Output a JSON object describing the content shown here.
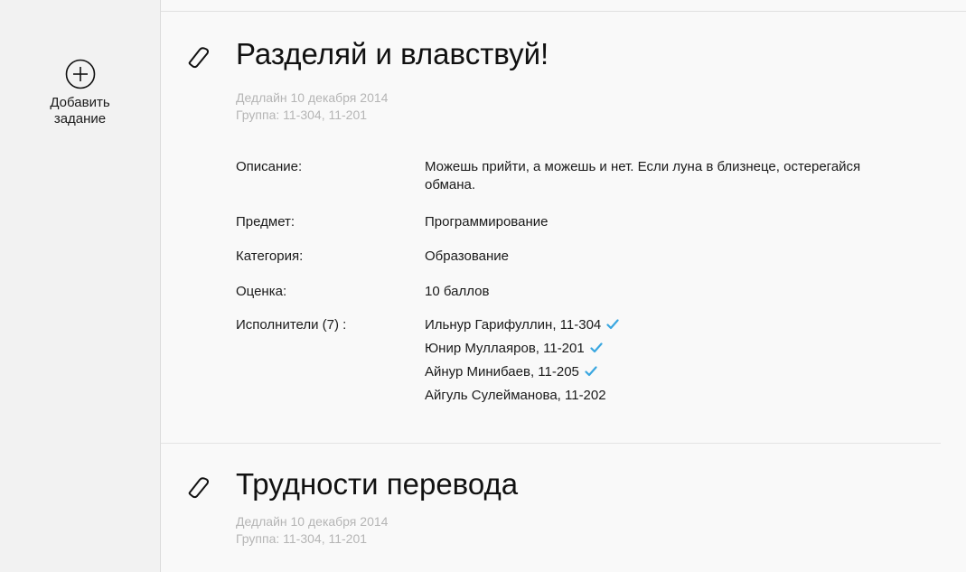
{
  "sidebar": {
    "add_task_label": "Добавить задание",
    "add_icon": "plus-circle-icon"
  },
  "colors": {
    "check": "#3aa7e0",
    "meta_text": "#b5b5b5",
    "background": "#f9f9f9",
    "sidebar": "#f2f2f2"
  },
  "tasks": [
    {
      "icon": "tag-icon",
      "title": "Разделяй и влавствуй!",
      "deadline": "Дедлайн 10 декабря 2014",
      "group": "Группа: 11-304, 11-201",
      "fields": {
        "description_label": "Описание:",
        "description_value": "Можешь прийти, а можешь и нет. Если луна в близнеце, остерегайся обмана.",
        "subject_label": "Предмет:",
        "subject_value": "Программирование",
        "category_label": "Категория:",
        "category_value": "Образование",
        "grade_label": "Оценка:",
        "grade_value": "10 баллов",
        "performers_label": "Исполнители (7) :"
      },
      "performers": [
        {
          "name": "Ильнур Гарифуллин, 11-304",
          "done": true
        },
        {
          "name": "Юнир Муллаяров, 11-201",
          "done": true
        },
        {
          "name": "Айнур Минибаев, 11-205",
          "done": true
        },
        {
          "name": "Айгуль Сулейманова, 11-202",
          "done": false
        }
      ]
    },
    {
      "icon": "tag-icon",
      "title": "Трудности перевода",
      "deadline": "Дедлайн 10 декабря 2014",
      "group": "Группа: 11-304, 11-201"
    }
  ]
}
